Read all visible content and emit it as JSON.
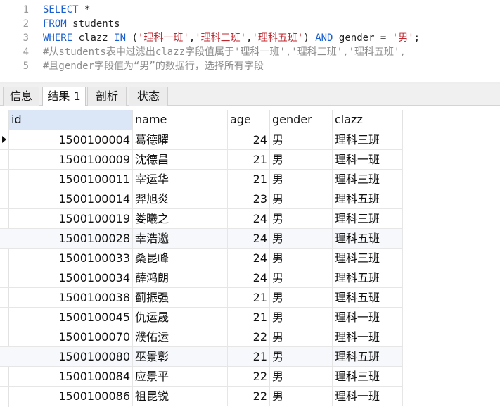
{
  "editor": {
    "lines": [
      {
        "num": "1",
        "tokens": [
          {
            "t": "kw",
            "v": "SELECT"
          },
          {
            "t": "id",
            "v": " *"
          }
        ]
      },
      {
        "num": "2",
        "tokens": [
          {
            "t": "kw",
            "v": "FROM"
          },
          {
            "t": "id",
            "v": " students"
          }
        ]
      },
      {
        "num": "3",
        "tokens": [
          {
            "t": "kw",
            "v": "WHERE"
          },
          {
            "t": "id",
            "v": " clazz "
          },
          {
            "t": "kw",
            "v": "IN"
          },
          {
            "t": "id",
            "v": " ("
          },
          {
            "t": "str",
            "v": "'理科一班'"
          },
          {
            "t": "id",
            "v": ","
          },
          {
            "t": "str",
            "v": "'理科三班'"
          },
          {
            "t": "id",
            "v": ","
          },
          {
            "t": "str",
            "v": "'理科五班'"
          },
          {
            "t": "id",
            "v": ") "
          },
          {
            "t": "kw",
            "v": "AND"
          },
          {
            "t": "id",
            "v": " gender = "
          },
          {
            "t": "str",
            "v": "'男'"
          },
          {
            "t": "id",
            "v": ";"
          }
        ]
      },
      {
        "num": "4",
        "tokens": [
          {
            "t": "cmt",
            "v": "#从students表中过滤出clazz字段值属于'理科一班','理科三班','理科五班',"
          }
        ]
      },
      {
        "num": "5",
        "tokens": [
          {
            "t": "cmt",
            "v": "#且gender字段值为“男”的数据行，选择所有字段"
          }
        ]
      }
    ]
  },
  "tabs": [
    {
      "label": "信息",
      "active": false
    },
    {
      "label": "结果 1",
      "active": true
    },
    {
      "label": "剖析",
      "active": false
    },
    {
      "label": "状态",
      "active": false
    }
  ],
  "table": {
    "columns": [
      "id",
      "name",
      "age",
      "gender",
      "clazz"
    ],
    "selected_column": "id",
    "current_row": 0,
    "rows": [
      [
        "1500100004",
        "葛德曜",
        "24",
        "男",
        "理科三班"
      ],
      [
        "1500100009",
        "沈德昌",
        "21",
        "男",
        "理科一班"
      ],
      [
        "1500100011",
        "宰运华",
        "21",
        "男",
        "理科三班"
      ],
      [
        "1500100014",
        "羿旭炎",
        "23",
        "男",
        "理科五班"
      ],
      [
        "1500100019",
        "娄曦之",
        "24",
        "男",
        "理科三班"
      ],
      [
        "1500100028",
        "幸浩邈",
        "24",
        "男",
        "理科五班"
      ],
      [
        "1500100033",
        "桑昆峰",
        "24",
        "男",
        "理科三班"
      ],
      [
        "1500100034",
        "薛鸿朗",
        "24",
        "男",
        "理科五班"
      ],
      [
        "1500100038",
        "蓟振强",
        "21",
        "男",
        "理科五班"
      ],
      [
        "1500100045",
        "仇运晟",
        "21",
        "男",
        "理科一班"
      ],
      [
        "1500100070",
        "濮佑运",
        "22",
        "男",
        "理科一班"
      ],
      [
        "1500100080",
        "巫景彰",
        "21",
        "男",
        "理科五班"
      ],
      [
        "1500100084",
        "应景平",
        "22",
        "男",
        "理科三班"
      ],
      [
        "1500100086",
        "祖昆锐",
        "22",
        "男",
        "理科一班"
      ]
    ]
  }
}
